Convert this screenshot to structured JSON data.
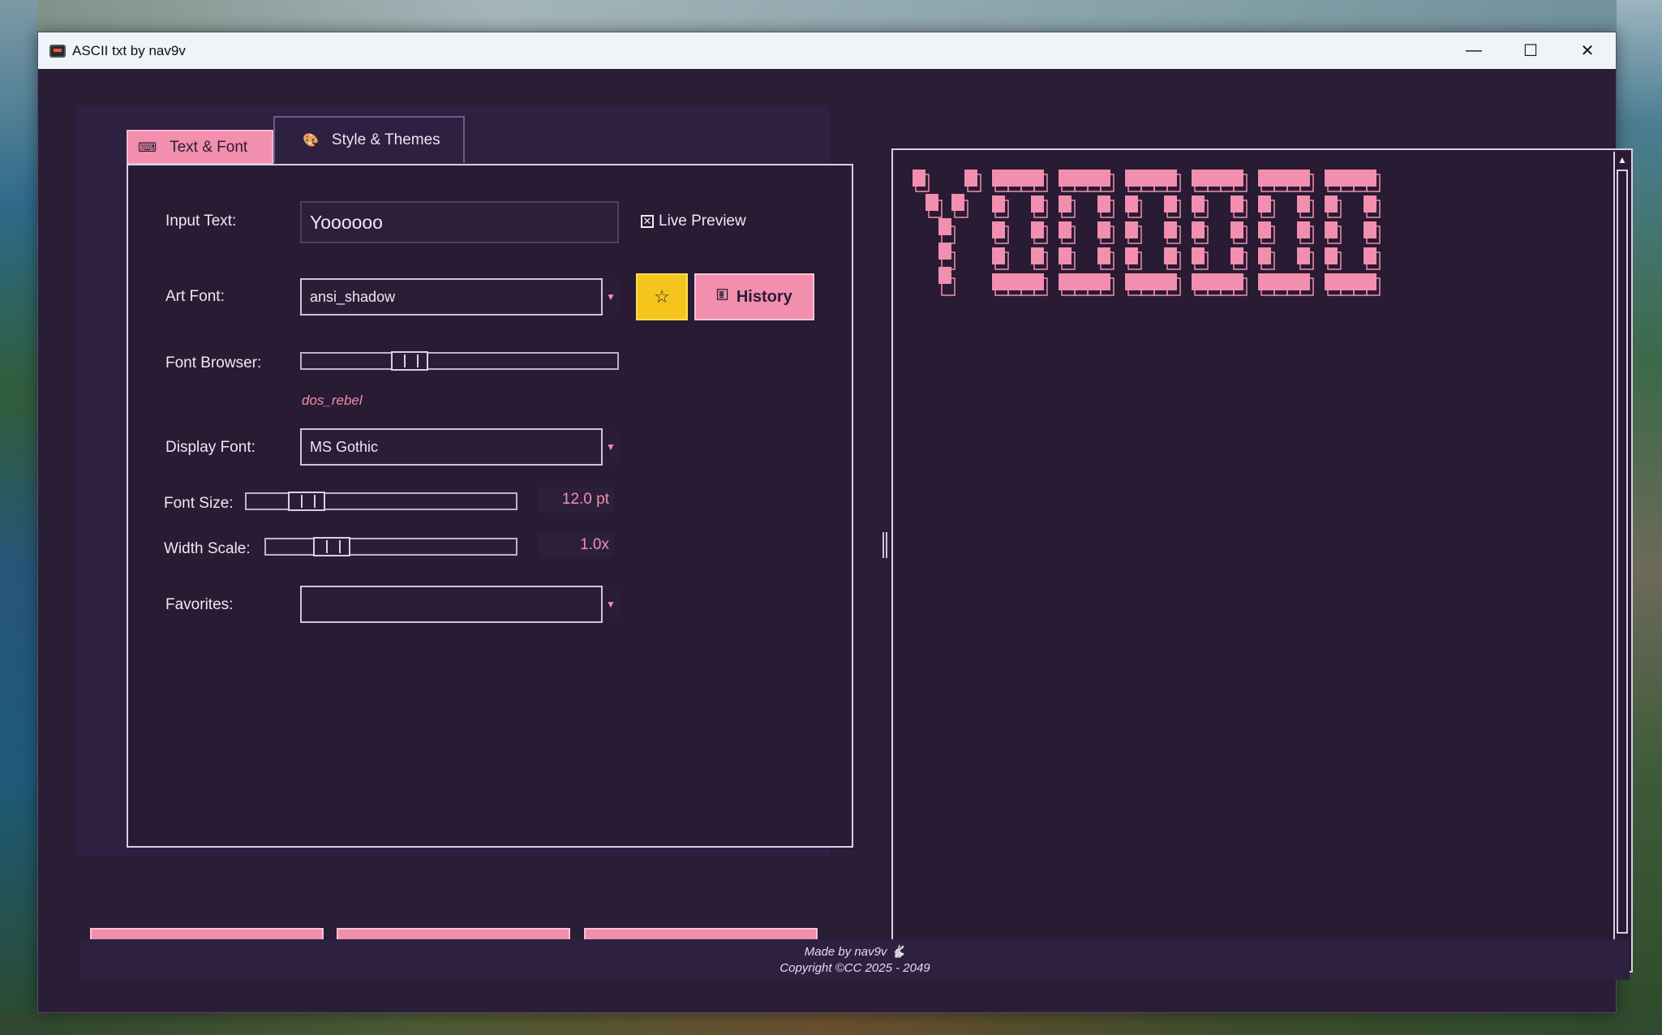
{
  "window": {
    "title": "ASCII txt by nav9v",
    "minimize_glyph": "—",
    "maximize_glyph": "☐",
    "close_glyph": "✕"
  },
  "tabs": [
    {
      "label": "Text & Font",
      "icon": "keyboard-icon",
      "active": true
    },
    {
      "label": "Style & Themes",
      "icon": "palette-icon",
      "active": false
    }
  ],
  "form": {
    "input_text_label": "Input Text:",
    "input_text_value": "Yoooooo",
    "live_preview_label": "Live Preview",
    "live_preview_checked": true,
    "art_font_label": "Art Font:",
    "art_font_value": "ansi_shadow",
    "favorite_star": "☆",
    "history_label": "History",
    "font_browser_label": "Font Browser:",
    "font_browser_hint": "dos_rebel",
    "font_browser_position": 0.32,
    "display_font_label": "Display Font:",
    "display_font_value": "MS Gothic",
    "font_size_label": "Font Size:",
    "font_size_value": "12.0 pt",
    "font_size_position": 0.18,
    "width_scale_label": "Width Scale:",
    "width_scale_value": "1.0x",
    "width_scale_position": 0.22,
    "favorites_label": "Favorites:",
    "favorites_value": ""
  },
  "preview": {
    "text": "Yoooooo",
    "color": "#f28eae"
  },
  "footer": {
    "line1": "Made by nav9v 🐇",
    "line2": "Copyright ©CC 2025 - 2049"
  },
  "colors": {
    "accent": "#f28eae",
    "background": "#2a1d36",
    "star": "#f6c51d"
  }
}
